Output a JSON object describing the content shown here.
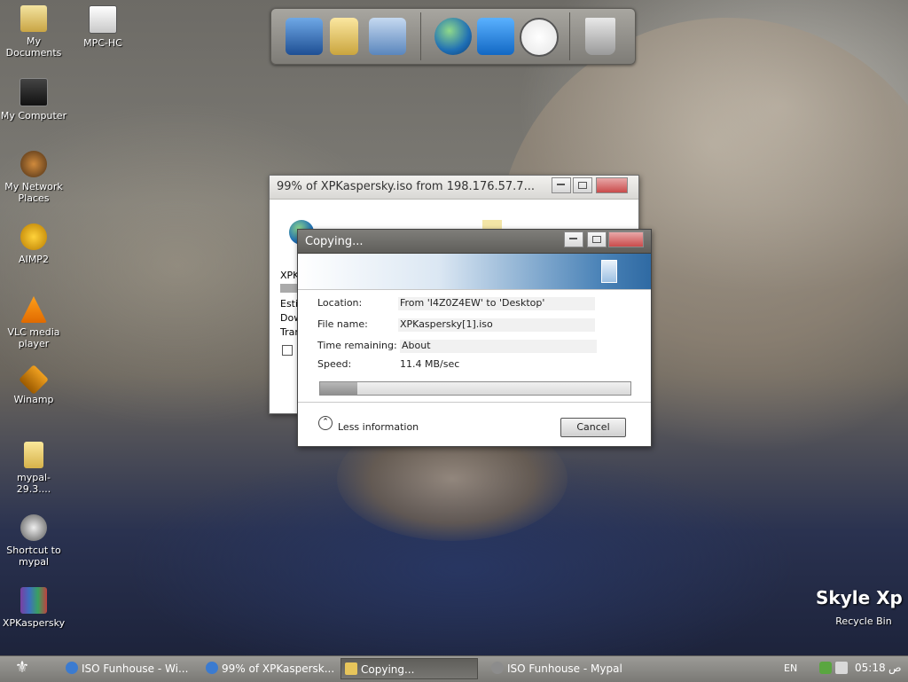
{
  "desktop_icons": [
    {
      "label": "My Documents",
      "icon": "folder-documents-icon"
    },
    {
      "label": "MPC-HC",
      "icon": "mpc-hc-icon"
    },
    {
      "label": "My Computer",
      "icon": "computer-icon"
    },
    {
      "label": "My Network Places",
      "icon": "network-icon"
    },
    {
      "label": "AIMP2",
      "icon": "aimp-icon"
    },
    {
      "label": "VLC media player",
      "icon": "vlc-icon"
    },
    {
      "label": "Winamp",
      "icon": "winamp-icon"
    },
    {
      "label": "mypal-29.3....",
      "icon": "folder-icon"
    },
    {
      "label": "Shortcut to mypal",
      "icon": "mypal-icon"
    },
    {
      "label": "XPKaspersky",
      "icon": "archive-icon"
    },
    {
      "label": "Recycle Bin",
      "icon": "recycle-bin-icon"
    }
  ],
  "watermark": "Skyle Xp",
  "dock_items": [
    "computer-icon",
    "documents-icon",
    "control-panel-icon",
    "globe-icon",
    "media-player-icon",
    "clock-icon",
    "trash-icon"
  ],
  "download_window": {
    "title": "99% of XPKaspersky.iso from 198.176.57.7...",
    "partial_labels": [
      "XPK",
      "Esti",
      "Dow",
      "Tran"
    ]
  },
  "copy_dialog": {
    "title": "Copying...",
    "location_label": "Location:",
    "location_value": "From 'I4Z0Z4EW' to 'Desktop'",
    "filename_label": "File name:",
    "filename_value": "XPKaspersky[1].iso",
    "time_label": "Time remaining:",
    "time_value": "About",
    "speed_label": "Speed:",
    "speed_value": "11.4 MB/sec",
    "progress": 0.12,
    "less_info": "Less information",
    "cancel": "Cancel"
  },
  "taskbar": {
    "items": [
      {
        "label": "ISO Funhouse - Wi...",
        "active": false
      },
      {
        "label": "99% of XPKaspersk...",
        "active": false
      },
      {
        "label": "Copying...",
        "active": true
      },
      {
        "label": "ISO Funhouse - Mypal",
        "active": false
      }
    ],
    "lang": "EN",
    "time": "05:18",
    "ampm": "ص"
  },
  "colors": {
    "accent": "#4c84b8",
    "taskbar": "#8a8985"
  }
}
